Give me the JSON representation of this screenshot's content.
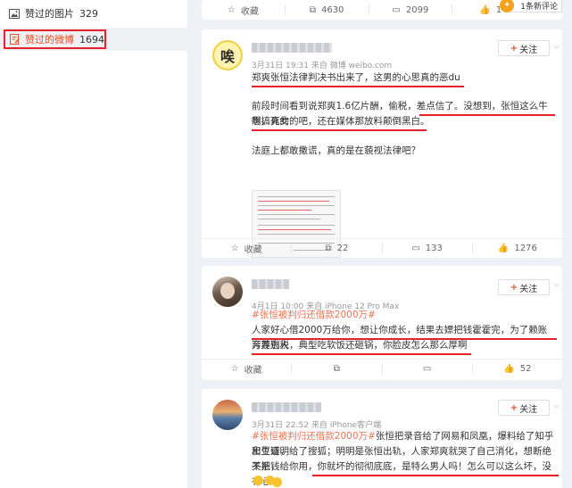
{
  "sidebar": {
    "items": [
      {
        "label": "赞过的图片",
        "count": "329"
      },
      {
        "label": "赞过的微博",
        "count": "1694"
      }
    ]
  },
  "top_card": {
    "favorite_label": "收藏",
    "repost_count": "4630",
    "comment_count": "2099",
    "like_count": "1",
    "new_notice": "1条新评论"
  },
  "posts": [
    {
      "avatar_char": "唉",
      "meta": "3月31日 19:31 来自 微博 weibo.com",
      "follow_label": "关注",
      "lines": [
        "郑爽张恒法律判决书出来了，这男的心思真的恶du",
        "前段时间看到说郑爽1.6亿片酬，偷税，差点信了。没想到，张恒这么牛啊，真的",
        "想搞死女的吧，还在媒体那放料颠倒黑白。",
        "法庭上都敢撒谎，真的是在藐视法律吧？"
      ],
      "favorite_label": "收藏",
      "repost_count": "22",
      "comment_count": "133",
      "like_count": "1276"
    },
    {
      "meta": "4月1日 10:00 来自 iPhone 12 Pro Max",
      "follow_label": "关注",
      "tag": "#张恒被判归还借款2000万#",
      "lines": [
        "人家好心借2000万给你，想让你成长，结果去嫖把钱霍霍完，为了赖账污蔑别人",
        "弃养逃税，典型吃软饭还砸锅，你脸皮怎么那么厚啊"
      ],
      "favorite_label": "收藏",
      "like_count": "52"
    },
    {
      "meta": "3月31日 22:52 来自 iPhone客户端",
      "follow_label": "关注",
      "tag": "#张恒被判归还借款2000万#",
      "line1_rest": "张恒把录音给了网易和凤凰，爆料给了知乎和豆瓣，",
      "lines": [
        "出生证明给了搜狐；明明是张恒出轨，人家郑爽就哭了自己消化，想断绝关系，",
        "不把钱给你用，你就坏的彻彻底底，是特么男人吗！怎么可以这么坏，没有心"
      ]
    }
  ],
  "colors": {
    "accent": "#f04a1e",
    "tag": "#eb7350",
    "highlight": "#e6212b"
  }
}
